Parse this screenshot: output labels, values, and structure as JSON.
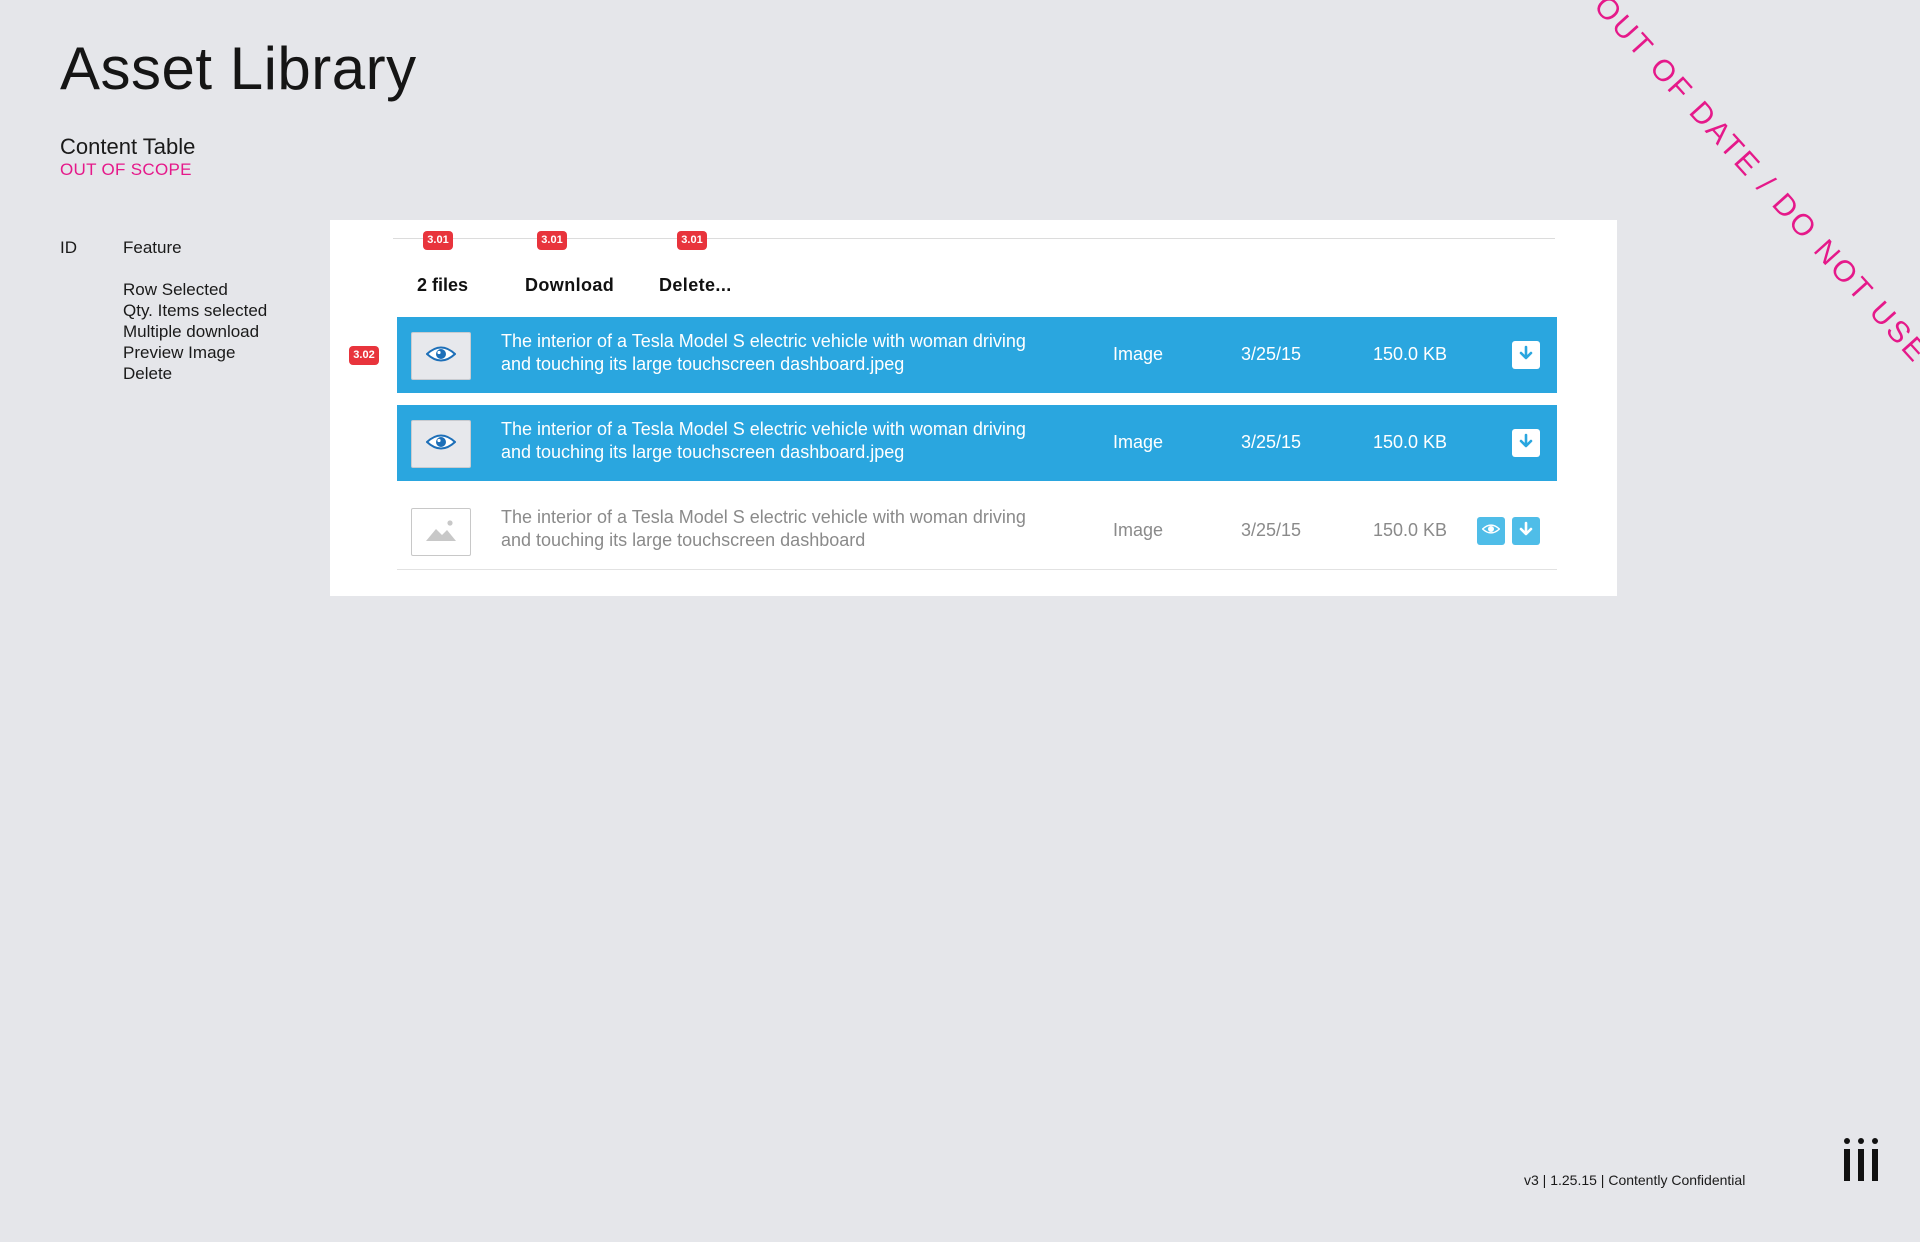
{
  "page": {
    "title": "Asset Library",
    "section": "Content Table",
    "scope_note": "OUT OF SCOPE",
    "watermark": "OUT OF DATE / DO NOT USE"
  },
  "legend": {
    "id_header": "ID",
    "feature_header": "Feature",
    "features": [
      "Row Selected",
      "Qty. Items selected",
      "Multiple download",
      "Preview Image",
      "Delete"
    ]
  },
  "toolbar": {
    "count_label": "2 files",
    "download_label": "Download",
    "delete_label": "Delete...",
    "badge": "3.01"
  },
  "row_badge": "3.02",
  "rows": [
    {
      "state": "selected",
      "name_line1": "The interior of a Tesla Model S electric vehicle with woman driving",
      "name_line2": "and touching its large touchscreen dashboard.jpeg",
      "type": "Image",
      "date": "3/25/15",
      "size": "150.0 KB",
      "thumb_icon": "eye-icon",
      "actions": [
        "download-icon"
      ]
    },
    {
      "state": "selected",
      "name_line1": "The interior of a Tesla Model S electric vehicle with woman driving",
      "name_line2": "and touching its large touchscreen dashboard.jpeg",
      "type": "Image",
      "date": "3/25/15",
      "size": "150.0 KB",
      "thumb_icon": "eye-icon",
      "actions": [
        "download-icon"
      ]
    },
    {
      "state": "default",
      "name_line1": "The interior of a Tesla Model S electric vehicle with woman driving",
      "name_line2": "and touching its large touchscreen dashboard",
      "type": "Image",
      "date": "3/25/15",
      "size": "150.0 KB",
      "thumb_icon": "image-placeholder-icon",
      "actions": [
        "eye-icon",
        "download-icon"
      ]
    }
  ],
  "footer": {
    "text": "v3  | 1.25.15  | Contently Confidential"
  },
  "colors": {
    "background": "#e5e6ea",
    "selected_row": "#2aa6df",
    "accent_pink": "#e5198a",
    "badge_red": "#e8343c",
    "action_blue": "#4fbde8"
  }
}
